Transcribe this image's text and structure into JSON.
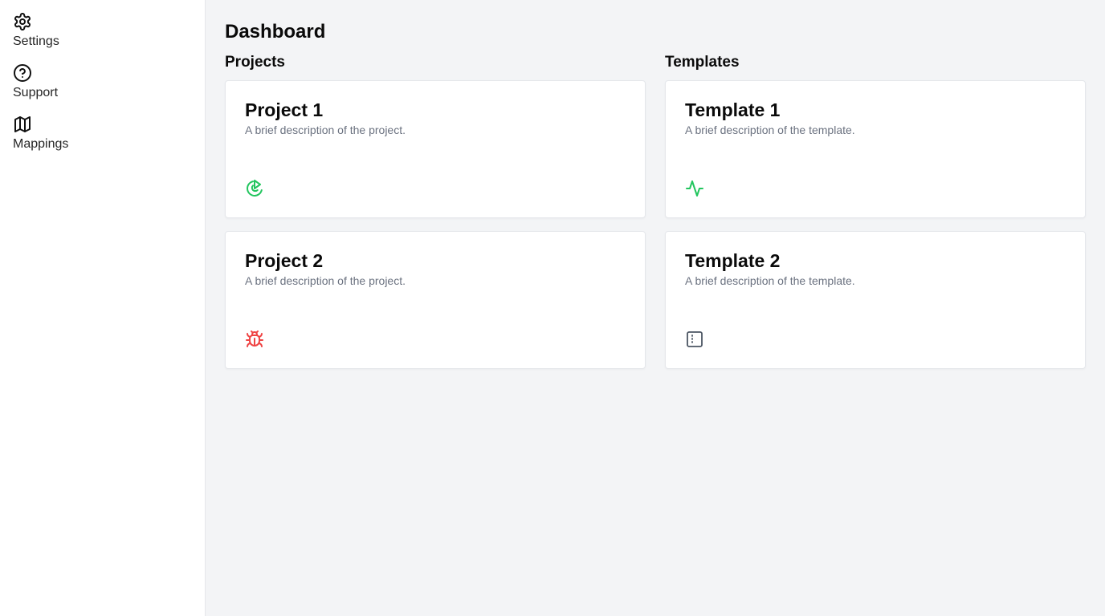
{
  "sidebar": {
    "items": [
      {
        "label": "Settings",
        "icon": "gear-icon"
      },
      {
        "label": "Support",
        "icon": "help-circle-icon"
      },
      {
        "label": "Mappings",
        "icon": "map-icon"
      }
    ]
  },
  "main": {
    "title": "Dashboard",
    "projects": {
      "title": "Projects",
      "cards": [
        {
          "title": "Project 1",
          "description": "A brief description of the project.",
          "icon": "target-play-icon",
          "icon_color": "#22c55e"
        },
        {
          "title": "Project 2",
          "description": "A brief description of the project.",
          "icon": "bug-icon",
          "icon_color": "#ef4444"
        }
      ]
    },
    "templates": {
      "title": "Templates",
      "cards": [
        {
          "title": "Template 1",
          "description": "A brief description of the template.",
          "icon": "activity-icon",
          "icon_color": "#22c55e"
        },
        {
          "title": "Template 2",
          "description": "A brief description of the template.",
          "icon": "panel-icon",
          "icon_color": "#4b5563"
        }
      ]
    }
  },
  "colors": {
    "background": "#f3f4f6",
    "sidebar": "#ffffff",
    "card": "#ffffff",
    "muted_text": "#6b7280",
    "green": "#22c55e",
    "red": "#ef4444"
  }
}
